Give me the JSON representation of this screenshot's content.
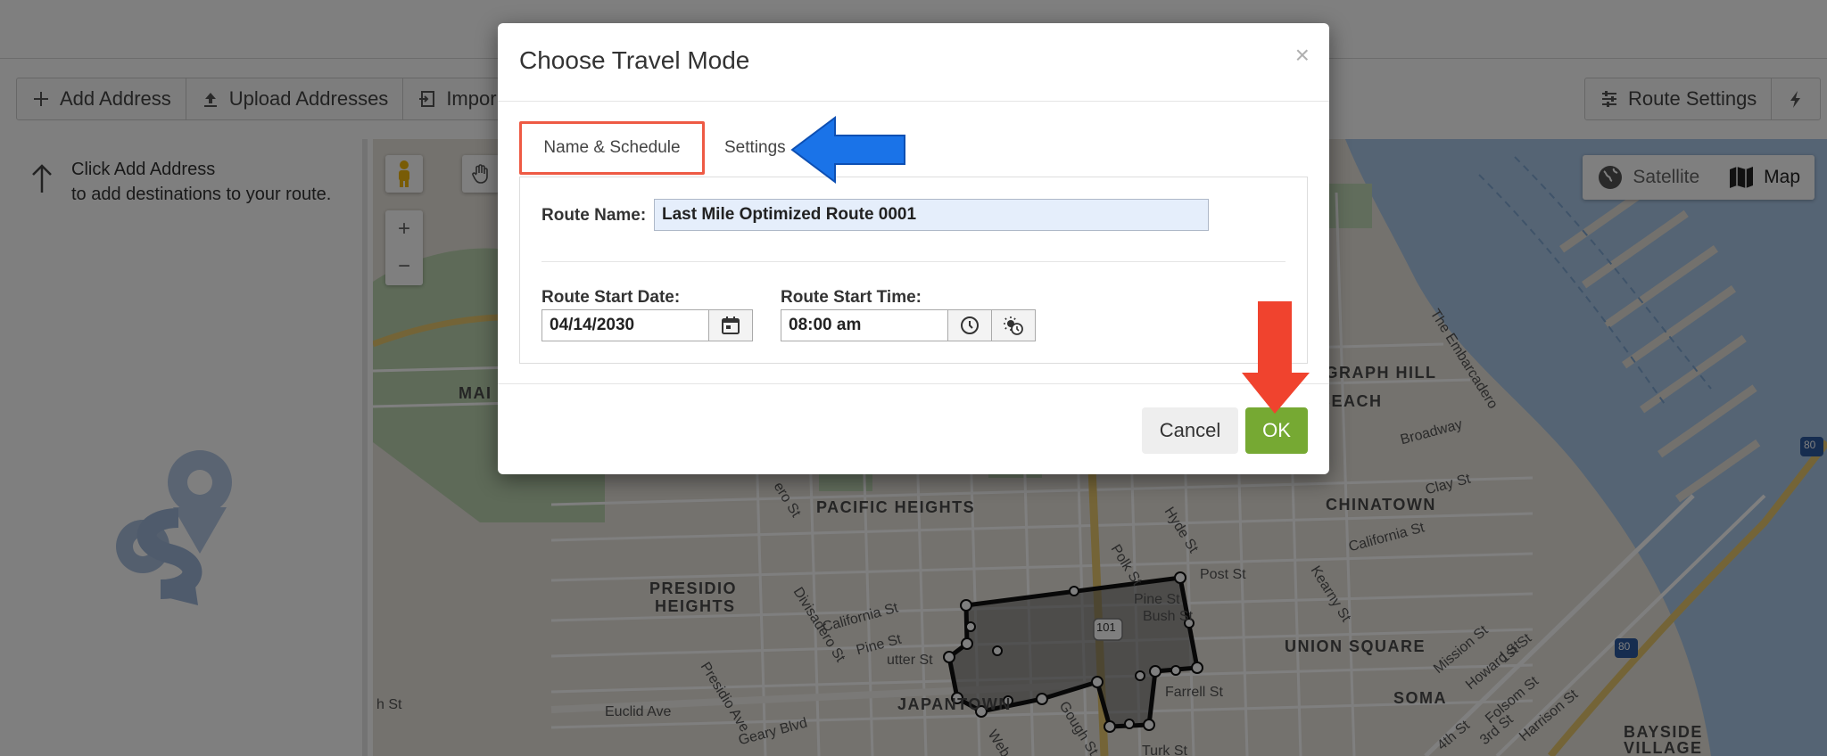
{
  "toolbar": {
    "left_buttons": [
      {
        "label": "Add Address",
        "icon": "plus-icon"
      },
      {
        "label": "Upload Addresses",
        "icon": "upload-icon"
      },
      {
        "label": "Impor",
        "icon": "import-icon"
      }
    ],
    "right_buttons": [
      {
        "label": "Route Settings",
        "icon": "sliders-icon"
      },
      {
        "label": "",
        "icon": "lightning-icon"
      }
    ]
  },
  "sidebar": {
    "hint_line1": "Click Add Address",
    "hint_line2": "to add destinations to your route."
  },
  "map": {
    "type_buttons": [
      "Satellite",
      "Map"
    ],
    "active_type": "Map",
    "zoom_in": "+",
    "zoom_out": "−",
    "labels": {
      "pacific_heights": "PACIFIC HEIGHTS",
      "presidio_heights_1": "PRESIDIO",
      "presidio_heights_2": "HEIGHTS",
      "chinatown": "CHINATOWN",
      "union_square": "UNION SQUARE",
      "soma": "SOMA",
      "bayside_1": "BAYSIDE",
      "bayside_2": "VILLAGE",
      "japantown": "JAPANTOWN",
      "telegraph_hill": "EGRAPH HILL",
      "beach": "BEACH",
      "marina": "MAI",
      "broadway": "Broadway",
      "clay_st": "Clay St",
      "california_st_east": "California St",
      "california_st_west": "California St",
      "pine_st_west": "Pine St",
      "pine_st_east": "Pine St",
      "bush_st": "Bush St",
      "post_st": "Post St",
      "farrell_st": "Farrell St",
      "turk_st": "Turk St",
      "geary_blvd": "Geary Blvd",
      "euclid_ave": "Euclid Ave",
      "sutter_st": "utter St",
      "divisadero_st": "Divisadero St",
      "presidio_ave": "Presidio Ave",
      "polk_st": "Polk St",
      "hyde_st": "Hyde St",
      "kearny_st": "Kearny St",
      "mission_st": "Mission St",
      "howard_st": "Howard St",
      "folsom_st": "Folsom St",
      "harrison_st": "Harrison St",
      "first_st": "1st St",
      "third_st": "3rd St",
      "fourth_st": "4th St",
      "embarcadero": "The Embarcadero",
      "gough_st": "Gough St",
      "webster_st": "Web",
      "ero_st": "ero St",
      "h_st": "h St",
      "hwy101": "101",
      "i80a": "80",
      "i80b": "80"
    }
  },
  "modal": {
    "title": "Choose Travel Mode",
    "close": "×",
    "tabs": [
      "Name & Schedule",
      "Settings"
    ],
    "active_tab": "Name & Schedule",
    "route_name_label": "Route Name:",
    "route_name_value": "Last Mile Optimized Route 0001",
    "start_date_label": "Route Start Date:",
    "start_date_value": "04/14/2030",
    "start_time_label": "Route Start Time:",
    "start_time_value": "08:00 am",
    "cancel_label": "Cancel",
    "ok_label": "OK"
  },
  "colors": {
    "ok_green": "#76a933",
    "tab_highlight": "#ee5a44",
    "blue_arrow": "#1a73e8",
    "red_arrow": "#f0432e",
    "input_blue": "#e5eefb"
  }
}
